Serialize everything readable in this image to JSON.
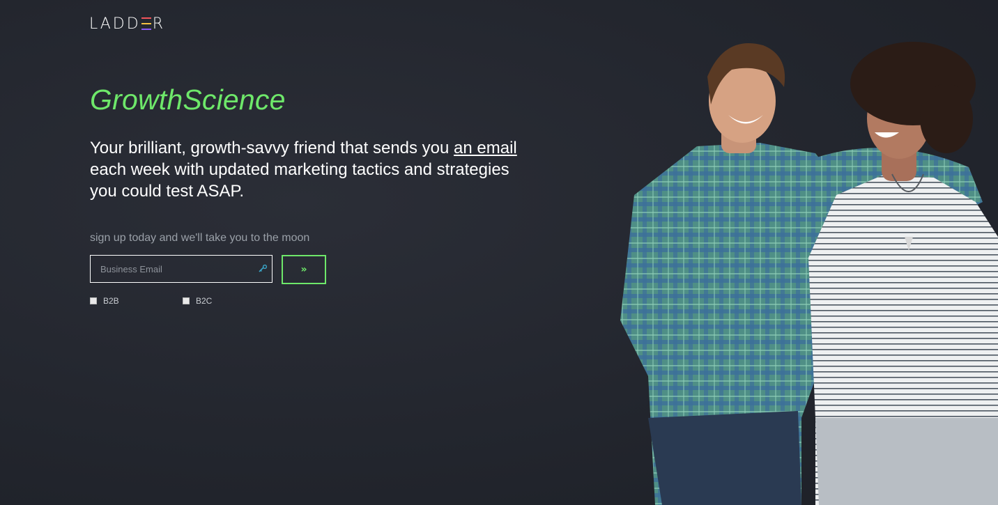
{
  "logo": {
    "text_part1": "LADD",
    "text_part2": "R"
  },
  "hero": {
    "title": "GrowthScience",
    "tagline_before": "Your brilliant, growth-savvy friend that sends you ",
    "tagline_link": "an email",
    "tagline_after": " each week with updated marketing tactics and strategies you could test ASAP."
  },
  "signup": {
    "prompt": "sign up today and we'll take you to the moon",
    "email_placeholder": "Business Email",
    "submit_label": "»"
  },
  "options": [
    {
      "label": "B2B",
      "checked": false
    },
    {
      "label": "B2C",
      "checked": false
    }
  ],
  "colors": {
    "accent": "#6ee86a",
    "background": "#23262e"
  }
}
